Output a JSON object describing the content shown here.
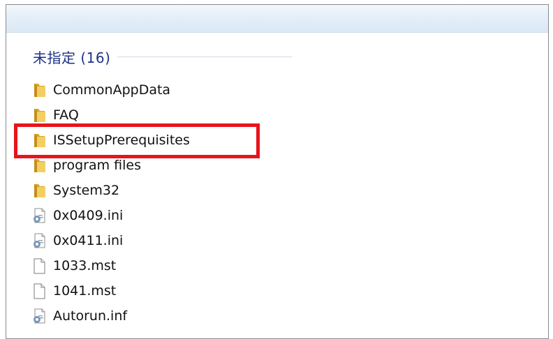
{
  "group": {
    "title": "未指定 (16)"
  },
  "items": [
    {
      "label": "CommonAppData",
      "icon": "folder-icon"
    },
    {
      "label": "FAQ",
      "icon": "folder-icon"
    },
    {
      "label": "ISSetupPrerequisites",
      "icon": "folder-icon",
      "highlighted": true
    },
    {
      "label": "program files",
      "icon": "folder-icon"
    },
    {
      "label": "System32",
      "icon": "folder-icon"
    },
    {
      "label": "0x0409.ini",
      "icon": "settings-file-icon"
    },
    {
      "label": "0x0411.ini",
      "icon": "settings-file-icon"
    },
    {
      "label": "1033.mst",
      "icon": "blank-file-icon"
    },
    {
      "label": "1041.mst",
      "icon": "blank-file-icon"
    },
    {
      "label": "Autorun.inf",
      "icon": "settings-file-icon"
    }
  ],
  "colors": {
    "group_title": "#1e3287",
    "highlight_border": "#e8141b",
    "folder": "#e8b83a"
  }
}
